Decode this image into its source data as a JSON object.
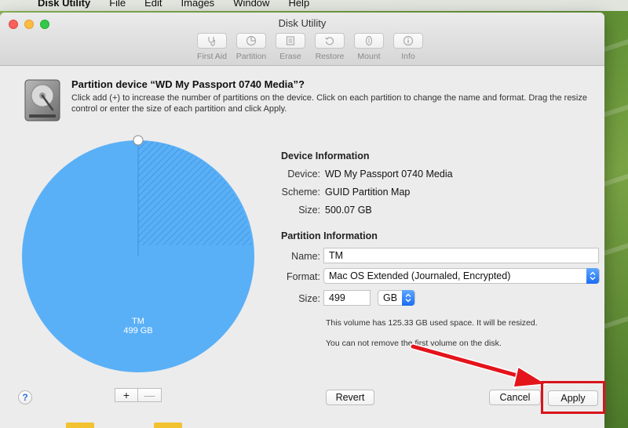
{
  "menubar": {
    "apple": "",
    "app_name": "Disk Utility",
    "items": [
      "File",
      "Edit",
      "Images",
      "Window",
      "Help"
    ]
  },
  "window": {
    "title": "Disk Utility",
    "toolbar": [
      {
        "label": "First Aid",
        "icon": "stethoscope-icon"
      },
      {
        "label": "Partition",
        "icon": "partition-icon"
      },
      {
        "label": "Erase",
        "icon": "erase-icon"
      },
      {
        "label": "Restore",
        "icon": "restore-icon"
      },
      {
        "label": "Mount",
        "icon": "mount-icon"
      },
      {
        "label": "Info",
        "icon": "info-icon"
      }
    ]
  },
  "sheet": {
    "title": "Partition device “WD My Passport 0740 Media”?",
    "description": "Click add (+) to increase the number of partitions on the device. Click on each partition to change the name and format. Drag the resize control or enter the size of each partition and click Apply.",
    "pie": {
      "partition_name": "TM",
      "partition_size": "499 GB",
      "color": "#5ab0f7"
    },
    "device_info": {
      "title": "Device Information",
      "device_label": "Device:",
      "device_value": "WD My Passport 0740 Media",
      "scheme_label": "Scheme:",
      "scheme_value": "GUID Partition Map",
      "size_label": "Size:",
      "size_value": "500.07 GB"
    },
    "partition_info": {
      "title": "Partition Information",
      "name_label": "Name:",
      "name_value": "TM",
      "format_label": "Format:",
      "format_value": "Mac OS Extended (Journaled, Encrypted)",
      "size_label": "Size:",
      "size_value": "499",
      "size_unit": "GB",
      "note_used": "This volume has 125.33 GB used space. It will be resized.",
      "note_remove": "You can not remove the first volume on the disk."
    },
    "buttons": {
      "help": "?",
      "add": "+",
      "remove": "—",
      "revert": "Revert",
      "cancel": "Cancel",
      "apply": "Apply"
    }
  },
  "colors": {
    "accent": "#1b6df2",
    "highlight_box": "#d8141b",
    "arrow": "#e3141b"
  }
}
